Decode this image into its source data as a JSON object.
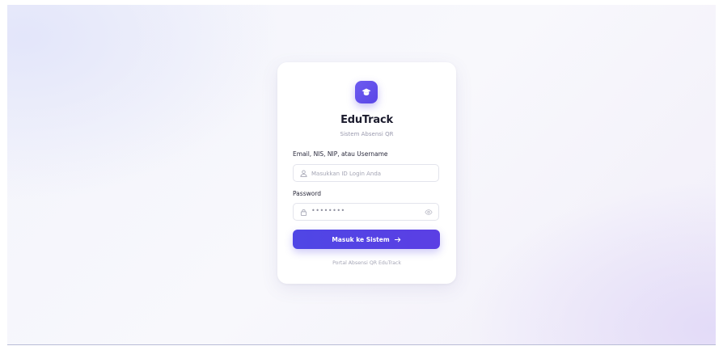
{
  "app": {
    "name": "EduTrack",
    "subtitle": "Sistem Absensi QR",
    "logo_icon": "graduation-cap-icon",
    "accent_color": "#5a46e6"
  },
  "form": {
    "login_label": "Email, NIS, NIP, atau Username",
    "login_placeholder": "Masukkan ID Login Anda",
    "login_value": "",
    "login_icon": "user-icon",
    "password_label": "Password",
    "password_value": "••••••••",
    "password_icon": "lock-icon",
    "password_toggle_icon": "eye-icon",
    "submit_label": "Masuk ke Sistem",
    "submit_icon": "arrow-right-icon"
  },
  "footer": {
    "text": "Portal Absensi QR EduTrack"
  }
}
